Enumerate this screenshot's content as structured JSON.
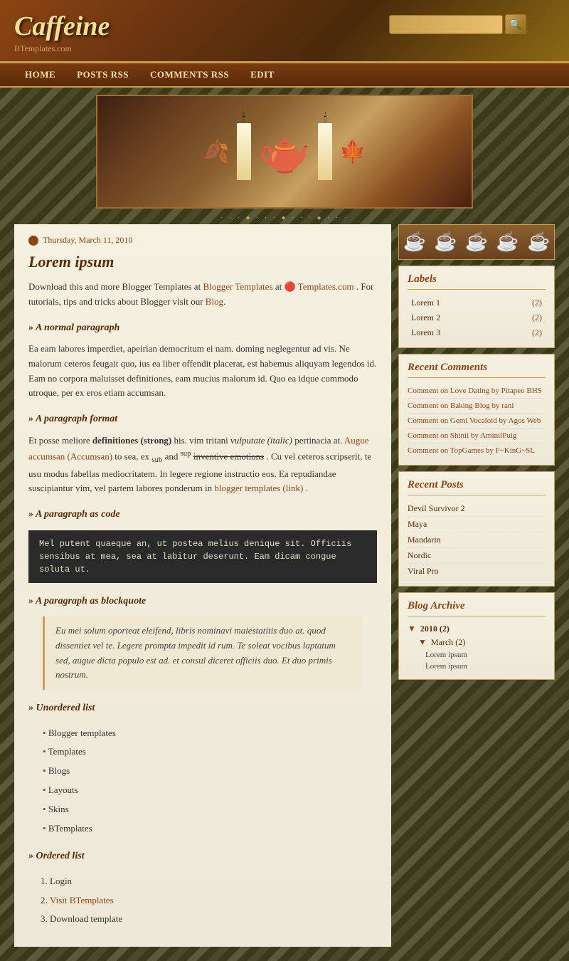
{
  "site": {
    "title": "Caffeine",
    "subtitle": "BTemplates.com"
  },
  "search": {
    "placeholder": "",
    "button_label": "🔍"
  },
  "nav": {
    "items": [
      {
        "label": "HOME",
        "href": "#"
      },
      {
        "label": "POSTS RSS",
        "href": "#"
      },
      {
        "label": "COMMENTS RSS",
        "href": "#"
      },
      {
        "label": "EDIT",
        "href": "#"
      }
    ]
  },
  "post": {
    "date": "Thursday, March 11, 2010",
    "title": "Lorem ipsum",
    "intro": "Download this and more Blogger Templates at",
    "intro2": ". For tutorials, tips and tricks about Blogger visit our",
    "intro3": "Blog",
    "intro_link_text": "BTemplates.com",
    "section1_label": "A normal paragraph",
    "section1_text": "Ea eam labores imperdiet, apeirian democritum ei nam. doming neglegentur ad vis. Ne malorum ceteros feugait quo, ius ea liber offendit placerat, est habemus aliquyam legendos id. Eam no corpora maluisset definitiones, eam mucius malorum id. Quo ea idque commodo utroque, per ex eros etiam accumsan.",
    "section2_label": "A paragraph format",
    "section2_text1": "Et posse meliore",
    "section2_bold": "definitiones (strong)",
    "section2_text2": " his. vim tritani ",
    "section2_italic": "vulputate (italic)",
    "section2_text3": " pertinacia at. ",
    "section2_link1": "Augue accumsan (Accumsan)",
    "section2_text4": " to sea, ex ",
    "section2_sub": "sub",
    "section2_text5": " and ",
    "section2_sup": "sup",
    "section2_text6": " ",
    "section2_strike": "inventive emotions",
    "section2_text7": ". Cu vel ceteros scripserit, te usu modus fabellas mediocritatem. In legere regione instructio eos. Ea repudiandae suscipiantur vim, vel partem labores ponderum in ",
    "section2_link2": "blogger templates (link)",
    "section2_text8": ".",
    "section3_label": "A paragraph as code",
    "section3_code": "Mel putent quaeque an, ut postea melius denique sit. Officiis sensibus\nat mea, sea at labitur deserunt. Eam dicam congue soluta ut.",
    "section4_label": "A paragraph as blockquote",
    "section4_quote": "Eu mei solum oporteat eleifend, libris nominavi maiestatitis duo at. quod dissentiet vel te. Legere prompta impedit id rum. Te soleat vocibus laptatum sed, augue dicta populo est ad. et consul diceret officiis duo. Et duo primis nostrum.",
    "section5_label": "Unordered list",
    "section5_items": [
      "Blogger templates",
      "Templates",
      "Blogs",
      "Layouts",
      "Skins",
      "BTemplates"
    ],
    "section6_label": "Ordered list",
    "section6_items": [
      "Login",
      "Visit BTemplates",
      "Download template"
    ]
  },
  "sidebar": {
    "cups": [
      "☕",
      "☕",
      "☕",
      "☕",
      "☕"
    ],
    "labels": {
      "title": "Labels",
      "items": [
        {
          "name": "Lorem 1",
          "count": "(2)"
        },
        {
          "name": "Lorem 2",
          "count": "(2)"
        },
        {
          "name": "Lorem 3",
          "count": "(2)"
        }
      ]
    },
    "recent_comments": {
      "title": "Recent Comments",
      "items": [
        {
          "text": "Comment on Love Dating by Pitapeo BHS"
        },
        {
          "text": "Comment on Baking Blog by rani"
        },
        {
          "text": "Comment on Gemi Vocaloid by Agos Web"
        },
        {
          "text": "Comment on Shinii by AminilPuig"
        },
        {
          "text": "Comment on TopGames by F~KinG~SL"
        }
      ]
    },
    "recent_posts": {
      "title": "Recent Posts",
      "items": [
        {
          "label": "Devil Survivor 2"
        },
        {
          "label": "Maya"
        },
        {
          "label": "Mandarin"
        },
        {
          "label": "Nordic"
        },
        {
          "label": "Viral Pro"
        }
      ]
    },
    "blog_archive": {
      "title": "Blog Archive",
      "years": [
        {
          "year": "2010",
          "count": "(2)",
          "months": [
            {
              "month": "March",
              "count": "(2)",
              "posts": [
                "Lorem ipsum",
                "Lorem ipsum"
              ]
            }
          ]
        }
      ]
    }
  }
}
